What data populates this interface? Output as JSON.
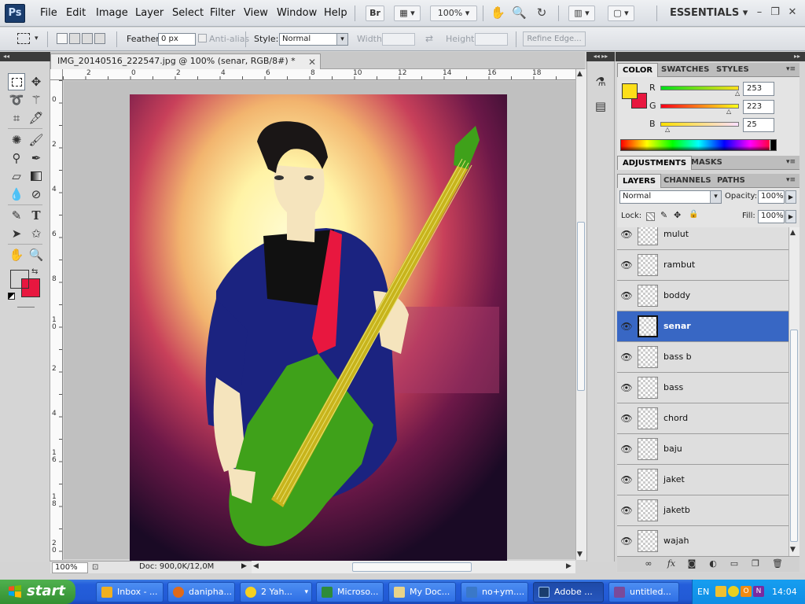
{
  "app": {
    "logo": "Ps"
  },
  "menu": [
    "File",
    "Edit",
    "Image",
    "Layer",
    "Select",
    "Filter",
    "View",
    "Window",
    "Help"
  ],
  "appbar": {
    "bridge": "Br",
    "zoom": "100%",
    "workspace": "ESSENTIALS"
  },
  "options": {
    "feather_label": "Feather:",
    "feather_value": "0 px",
    "antialias_label": "Anti-alias",
    "style_label": "Style:",
    "style_value": "Normal",
    "width_label": "Width:",
    "height_label": "Height:",
    "refine_label": "Refine Edge..."
  },
  "document": {
    "tab_title": "IMG_20140516_222547.jpg @ 100% (senar, RGB/8#) *",
    "ruler_h": [
      "2",
      "0",
      "2",
      "4",
      "6",
      "8",
      "10",
      "12",
      "14",
      "16",
      "18"
    ],
    "ruler_v": [
      "0",
      "2",
      "4",
      "6",
      "8",
      "1",
      "0",
      "2",
      "4",
      "1",
      "6",
      "1",
      "8",
      "2",
      "0"
    ],
    "status_zoom": "100%",
    "status_doc": "Doc: 900,0K/12,0M"
  },
  "colors": {
    "foreground": "#fddf19",
    "background": "#e8173f"
  },
  "color_panel": {
    "tabs": [
      "COLOR",
      "SWATCHES",
      "STYLES"
    ],
    "r_label": "R",
    "g_label": "G",
    "b_label": "B",
    "r": "253",
    "g": "223",
    "b": "25"
  },
  "adjust_panel": {
    "tabs": [
      "ADJUSTMENTS",
      "MASKS"
    ]
  },
  "layers_panel": {
    "tabs": [
      "LAYERS",
      "CHANNELS",
      "PATHS"
    ],
    "blend_mode": "Normal",
    "opacity_label": "Opacity:",
    "opacity": "100%",
    "lock_label": "Lock:",
    "fill_label": "Fill:",
    "fill": "100%",
    "layers": [
      {
        "name": "mulut",
        "selected": false
      },
      {
        "name": "rambut",
        "selected": false
      },
      {
        "name": "boddy",
        "selected": false
      },
      {
        "name": "senar",
        "selected": true
      },
      {
        "name": "bass b",
        "selected": false
      },
      {
        "name": "bass",
        "selected": false
      },
      {
        "name": "chord",
        "selected": false
      },
      {
        "name": "baju",
        "selected": false
      },
      {
        "name": "jaket",
        "selected": false
      },
      {
        "name": "jaketb",
        "selected": false
      },
      {
        "name": "wajah",
        "selected": false
      }
    ]
  },
  "taskbar": {
    "start_label": "start",
    "items": [
      {
        "label": "Inbox - ...",
        "color": "#f0b020"
      },
      {
        "label": "danipha...",
        "color": "#e06a1a"
      },
      {
        "label": "2 Yah...",
        "color": "#f5d020"
      },
      {
        "label": "Microso...",
        "color": "#2e8b3a"
      },
      {
        "label": "My Doc...",
        "color": "#e8d38a"
      },
      {
        "label": "no+ym....",
        "color": "#3a78c8"
      },
      {
        "label": "Adobe ...",
        "color": "#1a3d6e"
      },
      {
        "label": "untitled...",
        "color": "#7a4a9a"
      }
    ],
    "tray_lang": "EN",
    "clock": "14:04"
  }
}
